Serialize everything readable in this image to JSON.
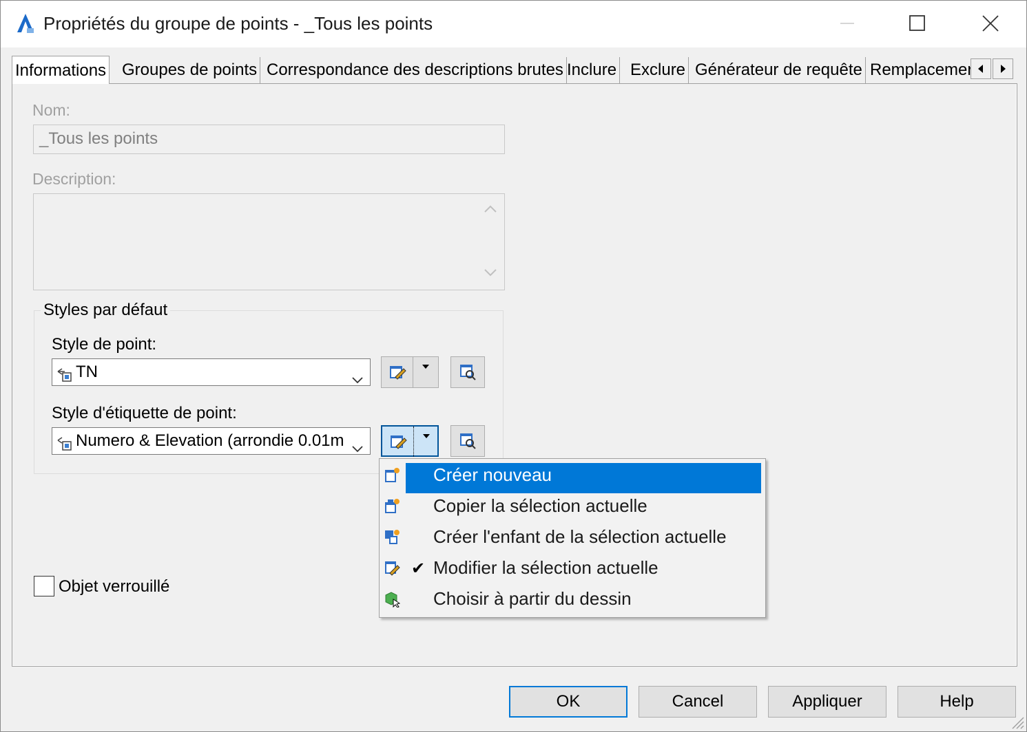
{
  "window": {
    "title": "Propriétés du groupe de points - _Tous les points"
  },
  "tabs": [
    {
      "label": "Informations",
      "active": true
    },
    {
      "label": "Groupes de points"
    },
    {
      "label": "Correspondance des descriptions brutes"
    },
    {
      "label": "Inclure"
    },
    {
      "label": "Exclure"
    },
    {
      "label": "Générateur de requête"
    },
    {
      "label": "Remplacemer"
    }
  ],
  "form": {
    "name_label": "Nom:",
    "name_value": "_Tous les points",
    "description_label": "Description:",
    "description_value": "",
    "group_title": "Styles par défaut",
    "point_style_label": "Style de point:",
    "point_style_value": "TN",
    "label_style_label": "Style d'étiquette de point:",
    "label_style_value": "Numero & Elevation (arrondie 0.01m",
    "locked_label": "Objet verrouillé",
    "locked_checked": false
  },
  "menu": {
    "items": [
      {
        "label": "Créer nouveau",
        "highlighted": true,
        "checked": false,
        "icon": "create-new-icon"
      },
      {
        "label": "Copier la sélection actuelle",
        "checked": false,
        "icon": "copy-icon"
      },
      {
        "label": "Créer l'enfant de la sélection actuelle",
        "checked": false,
        "icon": "child-icon"
      },
      {
        "label": "Modifier la sélection actuelle",
        "checked": true,
        "icon": "edit-icon"
      },
      {
        "label": "Choisir à partir du dessin",
        "checked": false,
        "icon": "pick-icon"
      }
    ],
    "check_glyph": "✔"
  },
  "buttons": {
    "ok": "OK",
    "cancel": "Cancel",
    "apply": "Appliquer",
    "help": "Help"
  },
  "colors": {
    "accent": "#0078d7",
    "app_icon": "#1b6ac9"
  }
}
